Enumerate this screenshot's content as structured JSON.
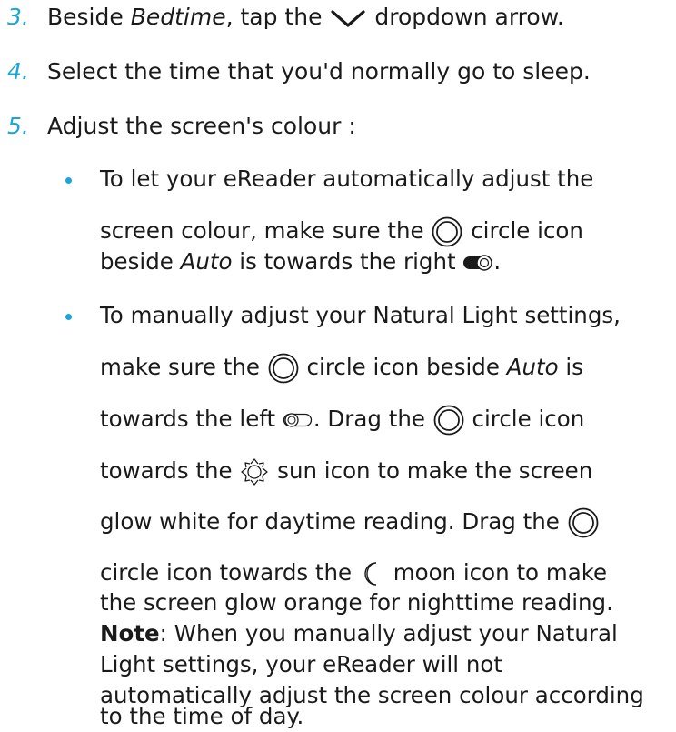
{
  "steps": [
    {
      "num": "3.",
      "pre": "Beside ",
      "em": "Bedtime",
      "mid": ", tap the ",
      "post": " dropdown arrow."
    },
    {
      "num": "4.",
      "text": "Select the time that you'd normally go to sleep."
    },
    {
      "num": "5.",
      "text": "Adjust the screen's colour :"
    }
  ],
  "bullet1": {
    "l1": "To let your eReader automatically adjust the",
    "l2a": "screen colour, make sure the ",
    "l2b": " circle icon",
    "l3a": "beside ",
    "l3em": "Auto",
    "l3b": " is towards the right ",
    "l3c": "."
  },
  "bullet2": {
    "l1": "To manually adjust your Natural Light settings,",
    "l2a": "make sure the ",
    "l2b": " circle icon beside ",
    "l2em": "Auto",
    "l2c": " is",
    "l3a": "towards the left ",
    "l3b": ". Drag the ",
    "l3c": " circle icon",
    "l4a": "towards the ",
    "l4b": " sun icon to make the screen",
    "l5a": "glow white for daytime reading. Drag the ",
    "l6a": "circle icon towards the ",
    "l6b": " moon icon to make",
    "l7": "the screen glow orange for nighttime reading.",
    "l8bold": "Note",
    "l8": ": When you manually adjust your Natural",
    "l9": "Light settings, your eReader will not",
    "l10": "automatically adjust the screen colour according",
    "l11": "to the time of day."
  },
  "icons": {
    "dropdown": "chevron-down-icon",
    "circle": "circle-icon",
    "toggle_on": "toggle-on-icon",
    "toggle_off": "toggle-off-icon",
    "sun": "sun-icon",
    "moon": "moon-icon"
  }
}
